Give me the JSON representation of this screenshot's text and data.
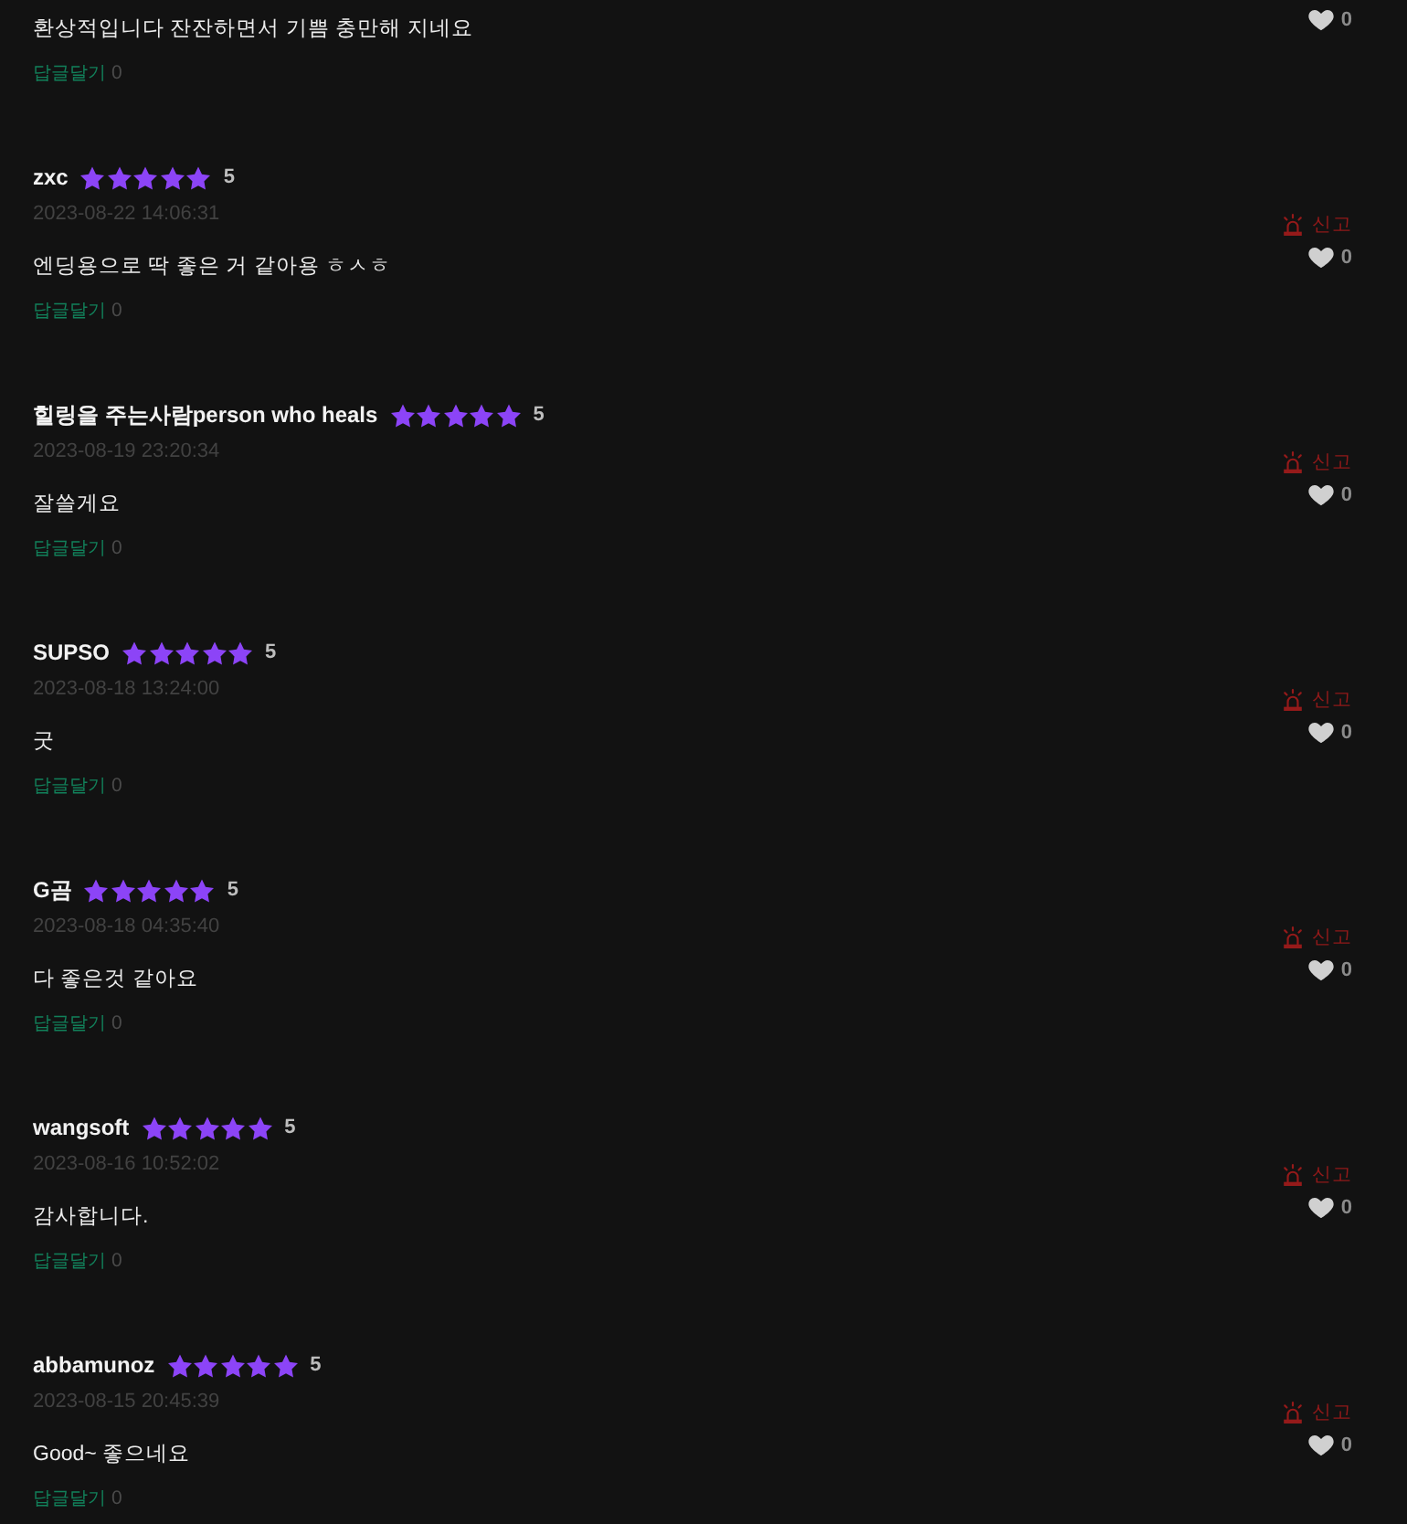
{
  "comments": [
    {
      "text": "환상적입니다 잔잔하면서 기쁨 충만해 지네요",
      "reply_label": "답글달기",
      "reply_count": "0",
      "likes": "0"
    },
    {
      "user": "zxc",
      "stars": 5,
      "rating": "5",
      "date": "2023-08-22 14:06:31",
      "text": "엔딩용으로 딱 좋은 거 같아용 ㅎㅅㅎ",
      "reply_label": "답글달기",
      "reply_count": "0",
      "report_label": "신고",
      "likes": "0"
    },
    {
      "user": "힐링을 주는사람person who heals",
      "stars": 5,
      "rating": "5",
      "date": "2023-08-19 23:20:34",
      "text": "잘쓸게요",
      "reply_label": "답글달기",
      "reply_count": "0",
      "report_label": "신고",
      "likes": "0"
    },
    {
      "user": "SUPSO",
      "stars": 5,
      "rating": "5",
      "date": "2023-08-18 13:24:00",
      "text": "굿",
      "reply_label": "답글달기",
      "reply_count": "0",
      "report_label": "신고",
      "likes": "0"
    },
    {
      "user": "G곰",
      "stars": 5,
      "rating": "5",
      "date": "2023-08-18 04:35:40",
      "text": "다 좋은것 같아요",
      "reply_label": "답글달기",
      "reply_count": "0",
      "report_label": "신고",
      "likes": "0"
    },
    {
      "user": "wangsoft",
      "stars": 5,
      "rating": "5",
      "date": "2023-08-16 10:52:02",
      "text": "감사합니다.",
      "reply_label": "답글달기",
      "reply_count": "0",
      "report_label": "신고",
      "likes": "0"
    },
    {
      "user": "abbamunoz",
      "stars": 5,
      "rating": "5",
      "date": "2023-08-15 20:45:39",
      "text": "Good~ 좋으네요",
      "reply_label": "답글달기",
      "reply_count": "0",
      "report_label": "신고",
      "likes": "0"
    }
  ]
}
